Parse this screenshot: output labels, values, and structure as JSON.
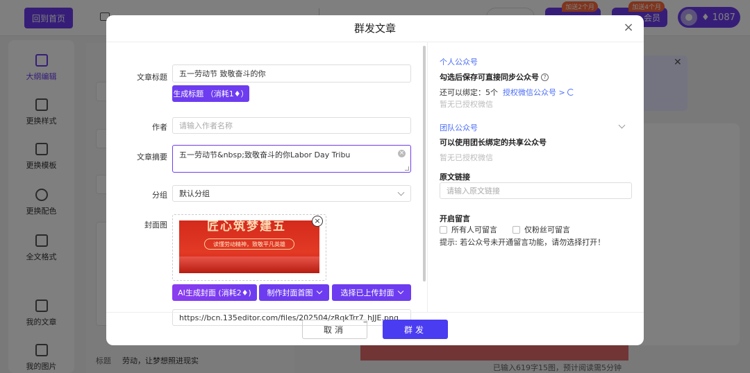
{
  "background": {
    "home_label": "回到首页",
    "vip_badge_1": "加送2个月",
    "vip_badge_2": "加送4个月",
    "vip_label": "会员",
    "balance": "♦ 1087",
    "sidebar": [
      {
        "label": "大纲编辑"
      },
      {
        "label": "更换样式"
      },
      {
        "label": "更换模板"
      },
      {
        "label": "更换配色"
      },
      {
        "label": "全文格式"
      },
      {
        "label": "我的文章"
      },
      {
        "label": "我的图片"
      }
    ],
    "editor_bottom_label": "标题",
    "editor_bottom_text": "劳动，让梦想照进现实",
    "word_count": "已输入619字15图，预计阅读需5分钟"
  },
  "modal": {
    "title": "群发文章",
    "fields": {
      "title_label": "文章标题",
      "title_value": "五一劳动节 致敬奋斗的你",
      "gen_title_btn": "生成标题 （消耗1♦）",
      "author_label": "作者",
      "author_placeholder": "请输入作者名称",
      "summary_label": "文章摘要",
      "summary_value": "五一劳动节&nbsp;致敬奋斗的你Labor Day Tribu",
      "group_label": "分组",
      "group_value": "默认分组",
      "cover_label": "封面图",
      "cover_top_text": "匠心筑梦建五",
      "cover_banner_text": "读懂劳动精神，致敬平凡英雄",
      "ai_cover_btn": "AI生成封面 (消耗2♦)",
      "make_cover_btn": "制作封面首图",
      "choose_cover_btn": "选择已上传封面",
      "cover_url": "https://bcn.135editor.com/files/202504/zRqkTrr7_hJJE.png"
    },
    "right": {
      "personal_head": "个人公众号",
      "personal_desc": "勾选后保存可直接同步公众号",
      "bind_prefix": "还可以绑定：5个",
      "bind_link": "授权微信公众号 >",
      "personal_empty": "暂无已授权微信",
      "team_head": "团队公众号",
      "team_desc": "可以使用团长绑定的共享公众号",
      "team_empty": "暂无已授权微信",
      "source_label": "原文链接",
      "source_placeholder": "请输入原文链接",
      "comment_label": "开启留言",
      "comment_all": "所有人可留言",
      "comment_fans": "仅粉丝可留言",
      "comment_tip": "提示: 若公众号未开通留言功能，请勿选择打开！"
    },
    "footer": {
      "cancel": "取消",
      "send": "群发"
    }
  }
}
